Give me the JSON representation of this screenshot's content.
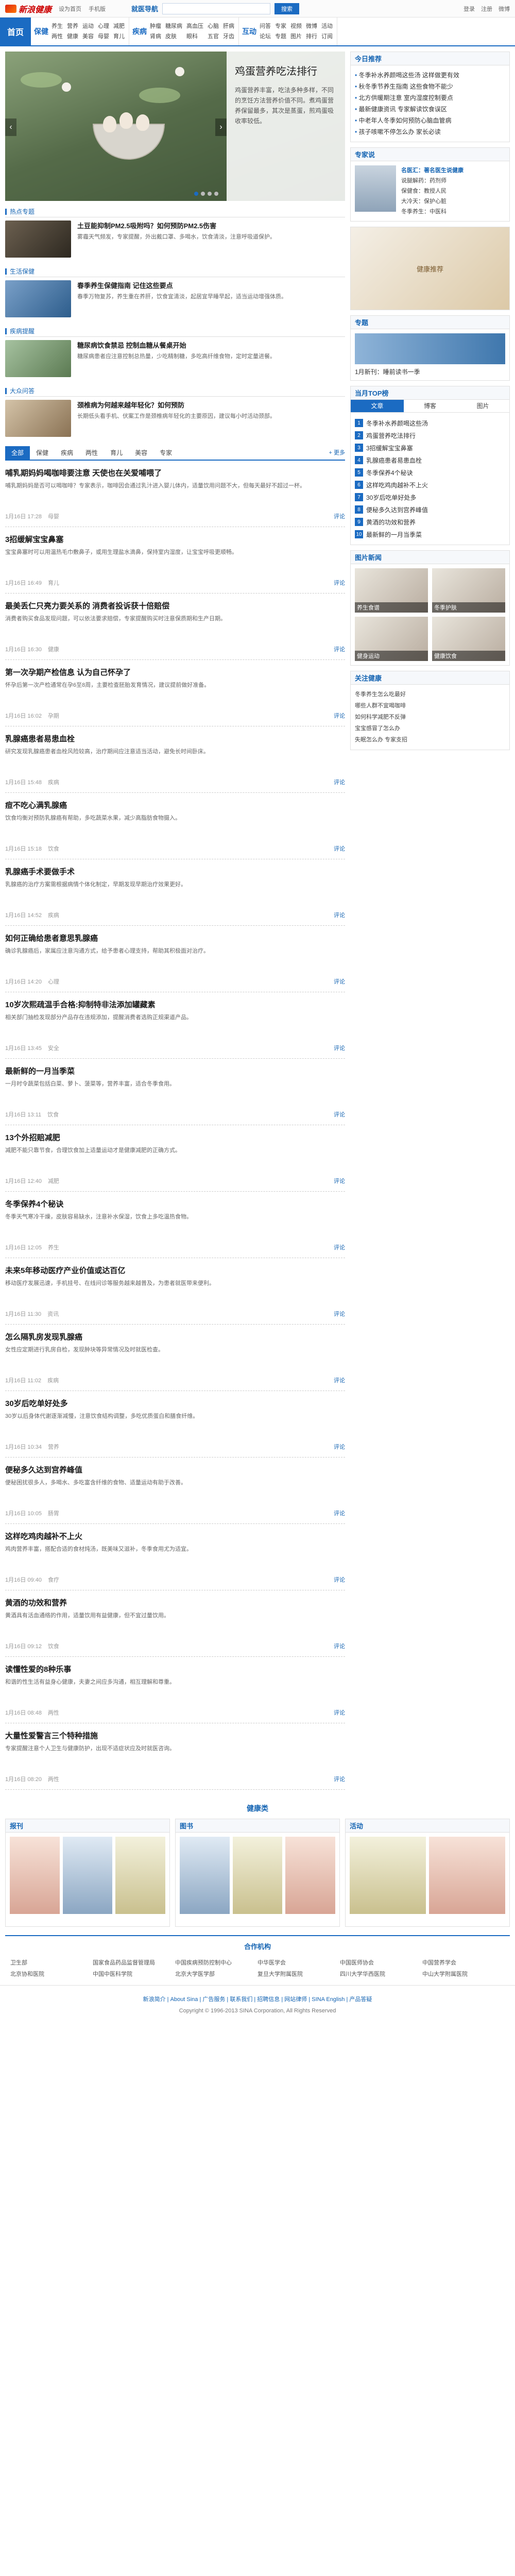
{
  "topbar": {
    "logo_text": "新浪健康",
    "links": [
      "设为首页",
      "手机版"
    ],
    "nav_title": "就医导航",
    "search_placeholder": "",
    "search_button": "搜索",
    "right": [
      "登录",
      "注册",
      "微博"
    ]
  },
  "channel": {
    "home": "首页",
    "groups": [
      {
        "name": "保健",
        "links": [
          "养生",
          "营养",
          "运动",
          "心理",
          "减肥",
          "两性",
          "健康",
          "美容",
          "母婴",
          "育儿"
        ]
      },
      {
        "name": "疾病",
        "links": [
          "肿瘤",
          "糖尿病",
          "高血压",
          "心脑",
          "肝病",
          "肾病",
          "皮肤",
          "眼科",
          "五官",
          "牙齿"
        ]
      },
      {
        "name": "互动",
        "links": [
          "问答",
          "专家",
          "视频",
          "微博",
          "活动",
          "论坛",
          "专题",
          "图片",
          "排行",
          "订阅"
        ]
      }
    ]
  },
  "hero": {
    "title": "鸡蛋营养吃法排行",
    "desc": "鸡蛋营养丰富，吃法多种多样，不同的烹饪方法营养价值不同。煮鸡蛋营养保留最多，其次是蒸蛋，煎鸡蛋吸收率较低。",
    "prev": "‹",
    "next": "›"
  },
  "topics": [
    {
      "label": "热点专题",
      "title": "土豆能抑制PM2.5吸附吗？如何预防PM2.5伤害",
      "desc": "雾霾天气频发，专家提醒，外出戴口罩、多喝水，饮食清淡，注意呼吸道保护。"
    },
    {
      "label": "生活保健",
      "title": "春季养生保健指南 记住这些要点",
      "desc": "春季万物复苏，养生重在养肝，饮食宜清淡，起居宜早睡早起，适当运动增强体质。"
    },
    {
      "label": "疾病提醒",
      "title": "糖尿病饮食禁忌 控制血糖从餐桌开始",
      "desc": "糖尿病患者应注意控制总热量，少吃精制糖，多吃高纤维食物，定时定量进餐。"
    },
    {
      "label": "大众问答",
      "title": "颈椎病为何越来越年轻化？如何预防",
      "desc": "长期低头看手机、伏案工作是颈椎病年轻化的主要原因，建议每小时活动颈部。"
    }
  ],
  "tabs": [
    "全部",
    "保健",
    "疾病",
    "两性",
    "育儿",
    "美容",
    "专家"
  ],
  "tabs_more": "+ 更多",
  "articles": [
    {
      "title": "哺乳期妈妈喝咖啡要注意 天使也在关爱哺喂了",
      "body": "哺乳期妈妈是否可以喝咖啡？专家表示，咖啡因会通过乳汁进入婴儿体内，适量饮用问题不大，但每天最好不超过一杯。",
      "date": "1月16日 17:28",
      "tag": "母婴"
    },
    {
      "title": "3招缓解宝宝鼻塞",
      "body": "宝宝鼻塞时可以用温热毛巾敷鼻子，或用生理盐水滴鼻，保持室内湿度，让宝宝呼吸更顺畅。",
      "date": "1月16日 16:49",
      "tag": "育儿"
    },
    {
      "title": "最美丢仁只亮力要关系的 消费者投诉获十倍赔偿",
      "body": "消费者购买食品发现问题，可以依法要求赔偿，专家提醒购买时注意保质期和生产日期。",
      "date": "1月16日 16:30",
      "tag": "健康"
    },
    {
      "title": "第一次孕期产检信息 认为自己怀孕了",
      "body": "怀孕后第一次产检通常在孕6至8周，主要检查胚胎发育情况，建议提前做好准备。",
      "date": "1月16日 16:02",
      "tag": "孕期"
    },
    {
      "title": "乳腺癌患者易患血栓",
      "body": "研究发现乳腺癌患者血栓风险较高，治疗期间应注意适当活动，避免长时间卧床。",
      "date": "1月16日 15:48",
      "tag": "疾病"
    },
    {
      "title": "痘不吃心满乳腺癌",
      "body": "饮食均衡对预防乳腺癌有帮助，多吃蔬菜水果，减少高脂肪食物摄入。",
      "date": "1月16日 15:18",
      "tag": "饮食"
    },
    {
      "title": "乳腺癌手术要做手术",
      "body": "乳腺癌的治疗方案需根据病情个体化制定，早期发现早期治疗效果更好。",
      "date": "1月16日 14:52",
      "tag": "疾病"
    },
    {
      "title": "如何正确给患者意思乳腺癌",
      "body": "确诊乳腺癌后，家属应注意沟通方式，给予患者心理支持，帮助其积极面对治疗。",
      "date": "1月16日 14:20",
      "tag": "心理"
    },
    {
      "title": "10岁次熙疏温手合格:抑制特非法添加罐藏素",
      "body": "相关部门抽检发现部分产品存在违规添加，提醒消费者选购正规渠道产品。",
      "date": "1月16日 13:45",
      "tag": "安全"
    },
    {
      "title": "最新鲜的一月当季菜",
      "body": "一月时令蔬菜包括白菜、萝卜、菠菜等，营养丰富，适合冬季食用。",
      "date": "1月16日 13:11",
      "tag": "饮食"
    },
    {
      "title": "13个外招赔减肥",
      "body": "减肥不能只靠节食，合理饮食加上适量运动才是健康减肥的正确方式。",
      "date": "1月16日 12:40",
      "tag": "减肥"
    },
    {
      "title": "冬季保养4个秘诀",
      "body": "冬季天气寒冷干燥，皮肤容易缺水，注意补水保湿，饮食上多吃温热食物。",
      "date": "1月16日 12:05",
      "tag": "养生"
    },
    {
      "title": "未来5年移动医疗产业价值或达百亿",
      "body": "移动医疗发展迅速，手机挂号、在线问诊等服务越来越普及，为患者就医带来便利。",
      "date": "1月16日 11:30",
      "tag": "资讯"
    },
    {
      "title": "怎么隔乳房发现乳腺癌",
      "body": "女性应定期进行乳房自检，发现肿块等异常情况及时就医检查。",
      "date": "1月16日 11:02",
      "tag": "疾病"
    },
    {
      "title": "30岁后吃单好处多",
      "body": "30岁以后身体代谢逐渐减慢，注意饮食结构调整，多吃优质蛋白和膳食纤维。",
      "date": "1月16日 10:34",
      "tag": "营养"
    },
    {
      "title": "便秘多久达到宫养峰值",
      "body": "便秘困扰很多人，多喝水、多吃富含纤维的食物、适量运动有助于改善。",
      "date": "1月16日 10:05",
      "tag": "肠胃"
    },
    {
      "title": "这样吃鸡肉越补不上火",
      "body": "鸡肉营养丰富，搭配合适的食材炖汤，既美味又滋补，冬季食用尤为适宜。",
      "date": "1月16日 09:40",
      "tag": "食疗"
    },
    {
      "title": "黄酒的功效和营养",
      "body": "黄酒具有活血通络的作用，适量饮用有益健康，但不宜过量饮用。",
      "date": "1月16日 09:12",
      "tag": "饮食"
    },
    {
      "title": "读懂性爱的8种乐事",
      "body": "和谐的性生活有益身心健康，夫妻之间应多沟通，相互理解和尊重。",
      "date": "1月16日 08:48",
      "tag": "两性"
    },
    {
      "title": "大量性爱警言三个特种措施",
      "body": "专家提醒注意个人卫生与健康防护，出现不适症状应及时就医咨询。",
      "date": "1月16日 08:20",
      "tag": "两性"
    }
  ],
  "article_more": "评论",
  "sidebar": {
    "today_title": "今日推荐",
    "today": [
      "冬季补水养颜喝这些汤 这样做更有效",
      "秋冬季节养生指南 这些食物不能少",
      "北方供暖期注意 室内湿度控制要点",
      "最新健康资讯 专家解读饮食误区",
      "中老年人冬季如何预防心脑血管病",
      "孩子咳嗽不停怎么办 家长必读"
    ],
    "expert_title": "专家说",
    "expert_name": "名医汇：著名医生说健康",
    "expert_lines": [
      "说腿解药：药剂师",
      "保健食：教授人民",
      "大冷天：保护心脏",
      "冬季养生：中医科"
    ],
    "ad_label": "健康推荐",
    "special_title": "专题",
    "special_item": "1月新刊：睡前读书一季",
    "rank_title": "当月TOP榜",
    "rank_tabs": [
      "文章",
      "博客",
      "图片"
    ],
    "rank": [
      "冬季补水养颜喝这些汤",
      "鸡蛋营养吃法排行",
      "3招缓解宝宝鼻塞",
      "乳腺癌患者易患血栓",
      "冬季保养4个秘诀",
      "这样吃鸡肉越补不上火",
      "30岁后吃单好处多",
      "便秘多久达到宫养峰值",
      "黄酒的功效和营养",
      "最新鲜的一月当季菜"
    ],
    "pic_title": "图片新闻",
    "pics": [
      "养生食谱",
      "冬季护肤",
      "健身运动",
      "健康饮食"
    ],
    "tags_title": "关注健康",
    "tags": [
      "冬季养生怎么吃最好",
      "哪些人群不宜喝咖啡",
      "如何科学减肥不反弹",
      "宝宝感冒了怎么办",
      "失眠怎么办 专家支招"
    ]
  },
  "bottom": {
    "title": "健康类",
    "media": [
      "报刊",
      "图书",
      "活动"
    ],
    "partners_title": "合作机构",
    "partners": [
      "卫生部",
      "国家食品药品监督管理局",
      "中国疾病预防控制中心",
      "中华医学会",
      "中国医师协会",
      "中国营养学会",
      "北京协和医院",
      "中国中医科学院",
      "北京大学医学部",
      "复旦大学附属医院",
      "四川大学华西医院",
      "中山大学附属医院"
    ],
    "footer_links": "新浪简介 | About Sina | 广告服务 | 联系我们 | 招聘信息 | 网站律师 | SINA English | 产品答疑",
    "copyright": "Copyright © 1996-2013 SINA Corporation, All Rights Reserved"
  }
}
